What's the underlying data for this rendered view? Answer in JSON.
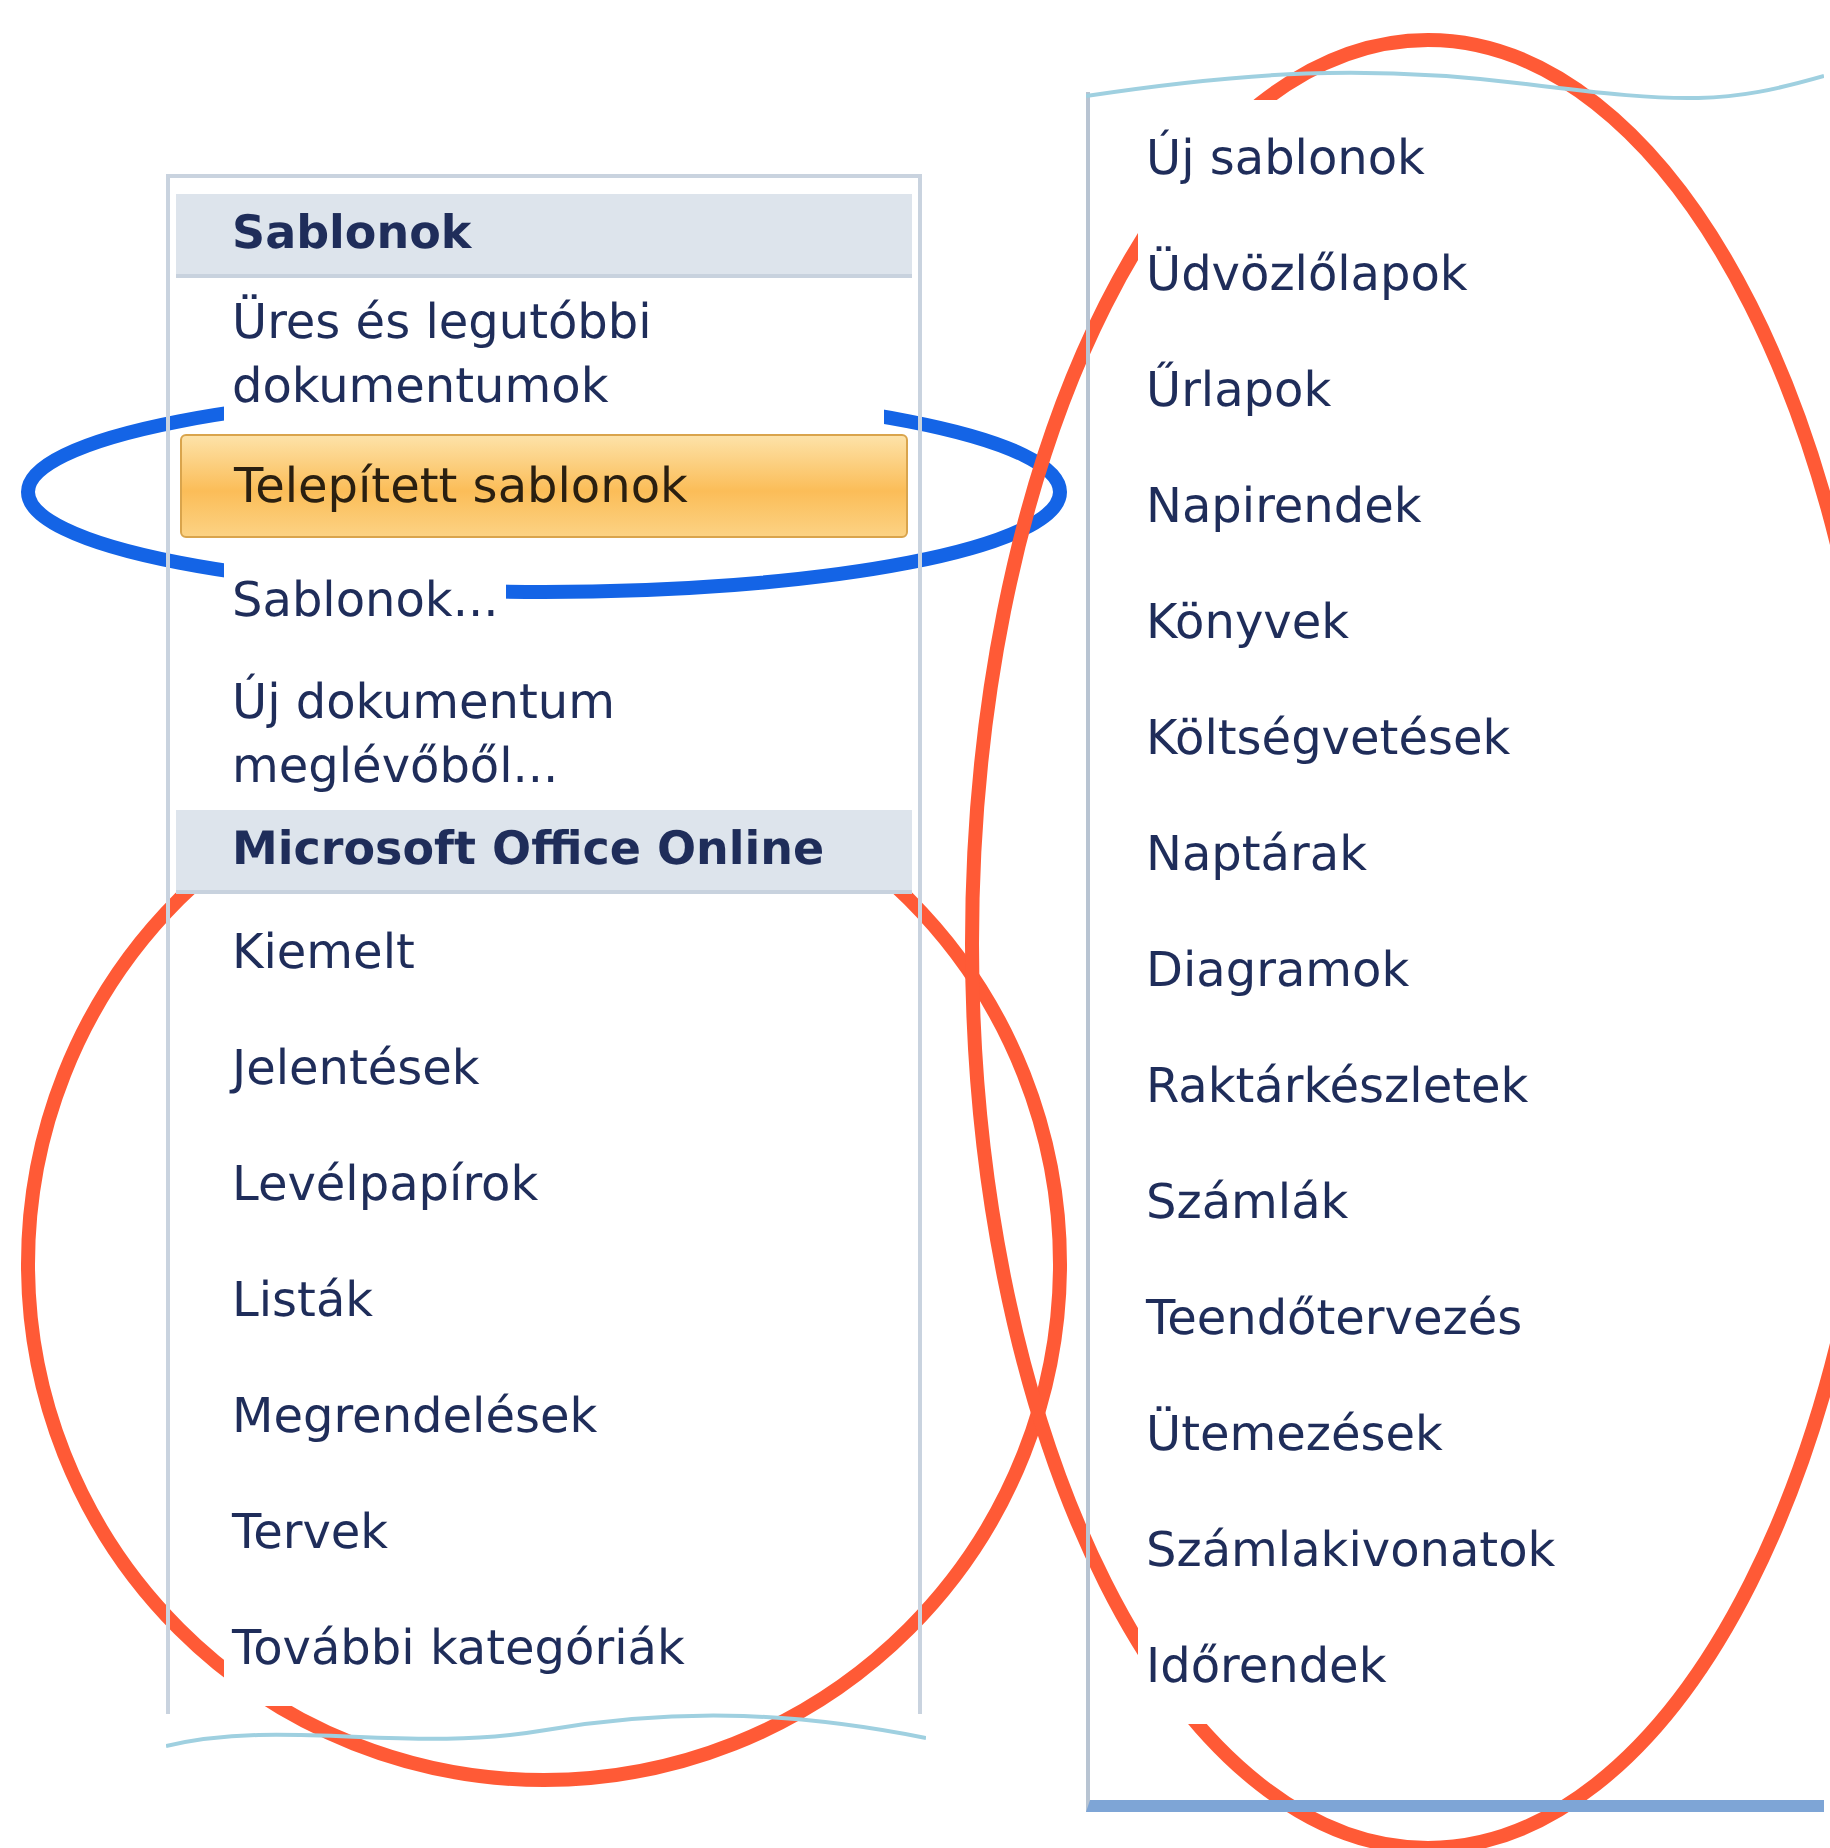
{
  "category_pane": {
    "sections": [
      {
        "header": "Sablonok",
        "items": [
          {
            "label": "Üres és legutóbbi dokumentumok",
            "selected": false
          },
          {
            "label": "Telepített sablonok",
            "selected": true
          },
          {
            "label": "Sablonok...",
            "selected": false
          },
          {
            "label": "Új dokumentum meglévőből...",
            "selected": false
          }
        ]
      },
      {
        "header": "Microsoft Office Online",
        "items": [
          {
            "label": "Kiemelt",
            "selected": false
          },
          {
            "label": "Jelentések",
            "selected": false
          },
          {
            "label": "Levélpapírok",
            "selected": false
          },
          {
            "label": "Listák",
            "selected": false
          },
          {
            "label": "Megrendelések",
            "selected": false
          },
          {
            "label": "Tervek",
            "selected": false
          },
          {
            "label": "További kategóriák",
            "selected": false
          }
        ]
      }
    ]
  },
  "online_categories": {
    "items": [
      {
        "label": "Új sablonok",
        "selected": false
      },
      {
        "label": "Üdvözlőlapok",
        "selected": false
      },
      {
        "label": "Űrlapok",
        "selected": false
      },
      {
        "label": "Napirendek",
        "selected": false
      },
      {
        "label": "Könyvek",
        "selected": false
      },
      {
        "label": "Költségvetések",
        "selected": false
      },
      {
        "label": "Naptárak",
        "selected": false
      },
      {
        "label": "Diagramok",
        "selected": false
      },
      {
        "label": "Raktárkészletek",
        "selected": false
      },
      {
        "label": "Számlák",
        "selected": false
      },
      {
        "label": "Teendőtervezés",
        "selected": false
      },
      {
        "label": "Ütemezések",
        "selected": false
      },
      {
        "label": "Számlakivonatok",
        "selected": false
      },
      {
        "label": "Időrendek",
        "selected": false
      }
    ]
  },
  "annotations": [
    {
      "color": "#1464e6"
    },
    {
      "color": "#ff5a36"
    },
    {
      "color": "#ff5a36"
    }
  ]
}
